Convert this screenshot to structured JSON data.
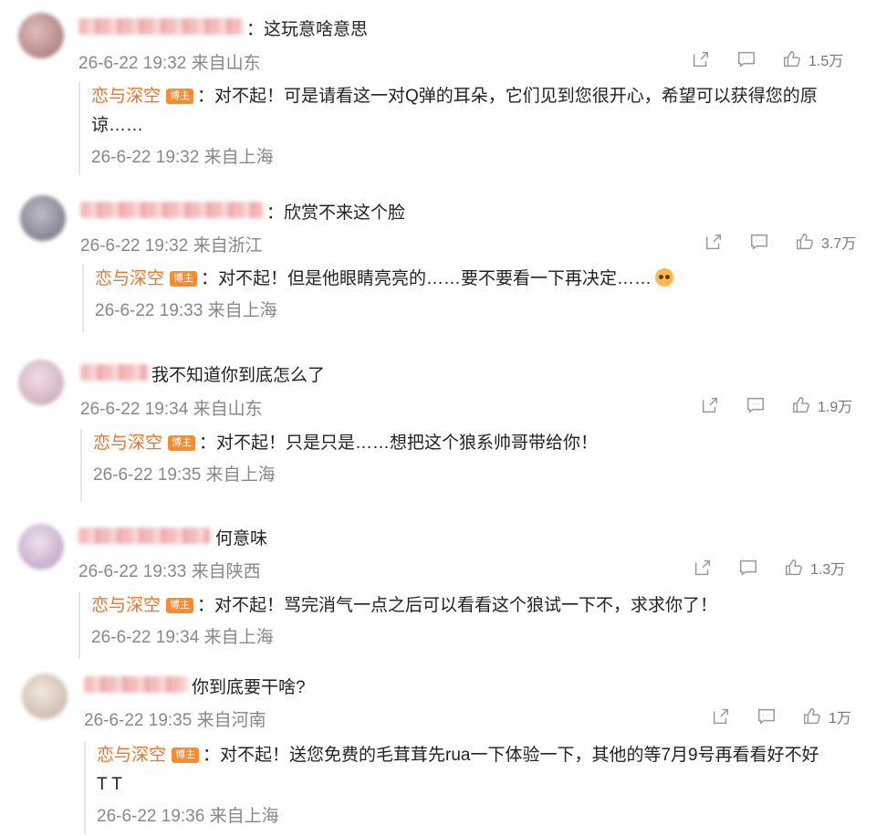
{
  "labels": {
    "badge": "博主"
  },
  "comments": [
    {
      "text": "这玩意啥意思",
      "time": "26-6-22 19:32 来自山东",
      "likes": "1.5万",
      "avatar_color": "#c9a0a0",
      "reply": {
        "name": "恋与深空",
        "text": "：对不起！可是请看这一对Q弹的耳朵，它们见到您很开心，希望可以获得您的原",
        "text2": "谅……",
        "time": "26-6-22 19:32 来自上海"
      }
    },
    {
      "text": "欣赏不来这个脸",
      "time": "26-6-22 19:32 来自浙江",
      "likes": "3.7万",
      "avatar_color": "#8a8a98",
      "reply": {
        "name": "恋与深空",
        "text": "：对不起！但是他眼睛亮亮的……要不要看一下再决定……",
        "time": "26-6-22 19:33 来自上海",
        "emoji": "pleading-face-emoji"
      }
    },
    {
      "text": "我不知道你到底怎么了",
      "time": "26-6-22 19:34 来自山东",
      "likes": "1.9万",
      "avatar_color": "#d9b8c8",
      "reply": {
        "name": "恋与深空",
        "text": "：对不起！只是只是……想把这个狼系帅哥带给你！",
        "time": "26-6-22 19:35 来自上海"
      }
    },
    {
      "text": "何意味",
      "time": "26-6-22 19:33 来自陕西",
      "likes": "1.3万",
      "avatar_color": "#c8b0c8",
      "reply": {
        "name": "恋与深空",
        "text": "：对不起！骂完消气一点之后可以看看这个狼试一下不，求求你了！",
        "time": "26-6-22 19:34 来自上海"
      }
    },
    {
      "text": "你到底要干啥?",
      "time": "26-6-22 19:35 来自河南",
      "likes": "1万",
      "avatar_color": "#d8c8b8",
      "reply": {
        "name": "恋与深空",
        "text": "：对不起！送您免费的毛茸茸先rua一下体验一下，其他的等7月9号再看看好不好",
        "text2": "T T",
        "time": "26-6-22 19:36 来自上海"
      }
    }
  ]
}
